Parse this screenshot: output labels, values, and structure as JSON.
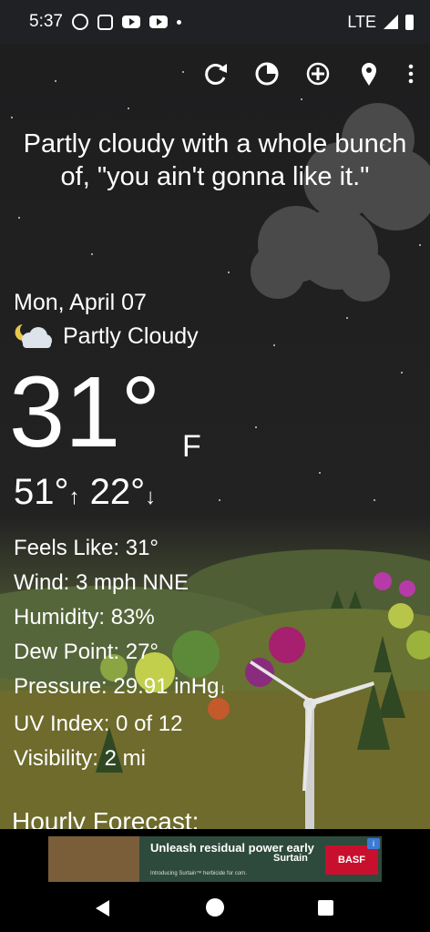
{
  "status_bar": {
    "time": "5:37",
    "network": "LTE"
  },
  "headline": "Partly cloudy with a whole bunch of, \"you ain't gonna like it.\"",
  "current": {
    "date": "Mon, April 07",
    "condition": "Partly Cloudy",
    "temperature": "31°",
    "unit": "F",
    "high": "51°",
    "low": "22°"
  },
  "details": {
    "feels_like": "Feels Like:  31°",
    "wind": "Wind:  3 mph NNE",
    "humidity": "Humidity:  83%",
    "dew_point": "Dew Point:  27°",
    "pressure": "Pressure:  29.91 inHg",
    "uv_index": "UV Index:  0 of 12",
    "visibility": "Visibility:  2 mi"
  },
  "hourly_title": "Hourly Forecast:",
  "ad": {
    "headline": "Unleash residual power early",
    "subtext": "Introducing Surtain™ herbicide for corn.",
    "brand": "Surtain",
    "sponsor": "BASF"
  },
  "icons": {
    "toolbar": [
      "refresh-icon",
      "radar-icon",
      "add-location-icon",
      "location-pin-icon",
      "more-options-icon"
    ],
    "condition": "partly-cloudy-night-icon"
  },
  "colors": {
    "background": "#1e1e1f",
    "text": "#ffffff",
    "ad_accent": "#c8102e"
  }
}
